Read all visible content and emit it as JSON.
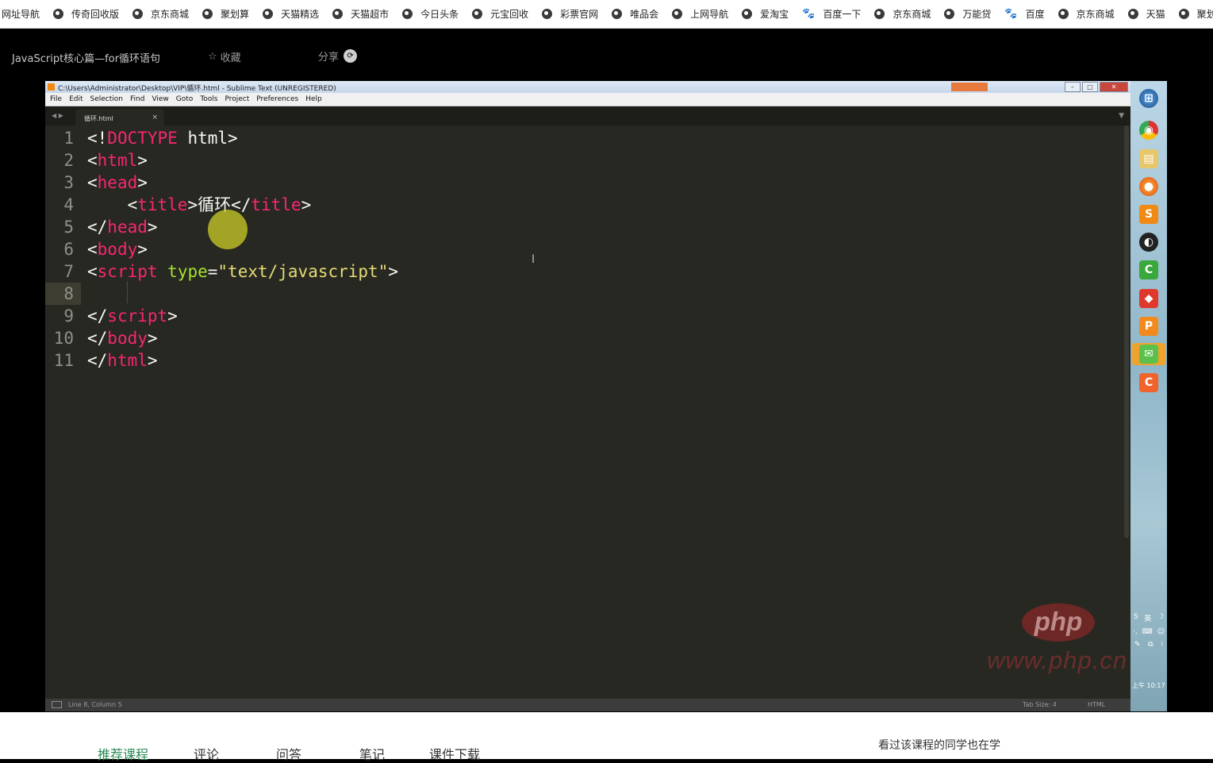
{
  "bookmarks": [
    {
      "label": "网址导航",
      "icon": "none"
    },
    {
      "label": "传奇回收版",
      "icon": "globe-icon"
    },
    {
      "label": "京东商城",
      "icon": "globe-icon"
    },
    {
      "label": "聚划算",
      "icon": "globe-icon"
    },
    {
      "label": "天猫精选",
      "icon": "globe-icon"
    },
    {
      "label": "天猫超市",
      "icon": "globe-icon"
    },
    {
      "label": "今日头条",
      "icon": "globe-icon"
    },
    {
      "label": "元宝回收",
      "icon": "globe-icon"
    },
    {
      "label": "彩票官网",
      "icon": "globe-icon"
    },
    {
      "label": "唯品会",
      "icon": "globe-icon"
    },
    {
      "label": "上网导航",
      "icon": "globe-icon"
    },
    {
      "label": "爱淘宝",
      "icon": "globe-icon"
    },
    {
      "label": "百度一下",
      "icon": "baidu-paw-icon"
    },
    {
      "label": "京东商城",
      "icon": "globe-icon"
    },
    {
      "label": "万能贷",
      "icon": "globe-icon"
    },
    {
      "label": "百度",
      "icon": "baidu-paw-icon"
    },
    {
      "label": "京东商城",
      "icon": "globe-icon"
    },
    {
      "label": "天猫",
      "icon": "globe-icon"
    },
    {
      "label": "聚划",
      "icon": "globe-icon"
    }
  ],
  "video": {
    "title": "JavaScript核心篇—for循环语句",
    "favorite_label": "收藏",
    "share_label": "分享"
  },
  "sublime": {
    "window_title": "C:\\Users\\Administrator\\Desktop\\VIP\\循环.html - Sublime Text (UNREGISTERED)",
    "menu": [
      "File",
      "Edit",
      "Selection",
      "Find",
      "View",
      "Goto",
      "Tools",
      "Project",
      "Preferences",
      "Help"
    ],
    "tab_name": "循环.html",
    "current_line": 8,
    "status_left": "Line 8, Column 5",
    "status_tab_size": "Tab Size: 4",
    "status_syntax": "HTML",
    "lines": [
      {
        "n": "1",
        "indent": "",
        "parts": [
          [
            "p",
            "<!"
          ],
          [
            "t",
            "DOCTYPE"
          ],
          [
            "p",
            " html>"
          ]
        ]
      },
      {
        "n": "2",
        "indent": "",
        "parts": [
          [
            "p",
            "<"
          ],
          [
            "t",
            "html"
          ],
          [
            "p",
            ">"
          ]
        ]
      },
      {
        "n": "3",
        "indent": "",
        "parts": [
          [
            "p",
            "<"
          ],
          [
            "t",
            "head"
          ],
          [
            "p",
            ">"
          ]
        ]
      },
      {
        "n": "4",
        "indent": "    ",
        "parts": [
          [
            "p",
            "<"
          ],
          [
            "t",
            "title"
          ],
          [
            "p",
            ">循环</"
          ],
          [
            "t",
            "title"
          ],
          [
            "p",
            ">"
          ]
        ]
      },
      {
        "n": "5",
        "indent": "",
        "parts": [
          [
            "p",
            "</"
          ],
          [
            "t",
            "head"
          ],
          [
            "p",
            ">"
          ]
        ]
      },
      {
        "n": "6",
        "indent": "",
        "parts": [
          [
            "p",
            "<"
          ],
          [
            "t",
            "body"
          ],
          [
            "p",
            ">"
          ]
        ]
      },
      {
        "n": "7",
        "indent": "",
        "parts": [
          [
            "p",
            "<"
          ],
          [
            "t",
            "script"
          ],
          [
            "p",
            " "
          ],
          [
            "a",
            "type"
          ],
          [
            "p",
            "="
          ],
          [
            "s",
            "\"text/javascript\""
          ],
          [
            "p",
            ">"
          ]
        ]
      },
      {
        "n": "8",
        "indent": "",
        "parts": []
      },
      {
        "n": "9",
        "indent": "",
        "parts": [
          [
            "p",
            "</"
          ],
          [
            "t",
            "script"
          ],
          [
            "p",
            ">"
          ]
        ]
      },
      {
        "n": "10",
        "indent": "",
        "parts": [
          [
            "p",
            "</"
          ],
          [
            "t",
            "body"
          ],
          [
            "p",
            ">"
          ]
        ]
      },
      {
        "n": "11",
        "indent": "",
        "parts": [
          [
            "p",
            "</"
          ],
          [
            "t",
            "html"
          ],
          [
            "p",
            ">"
          ]
        ]
      }
    ]
  },
  "watermark": {
    "logo": "php",
    "url": "www.php.cn"
  },
  "taskbar": {
    "apps": [
      "windows-start-icon",
      "chrome-icon",
      "file-explorer-icon",
      "firefox-icon",
      "sublime-icon",
      "obs-icon",
      "camtasia-green-icon",
      "app-red-icon",
      "orange-p-icon",
      "wechat-icon",
      "camtasia-orange-icon"
    ],
    "clock": "上午 10:17"
  },
  "bottom_tabs": [
    "推荐课程",
    "评论",
    "问答",
    "笔记",
    "课件下载"
  ],
  "related_title": "看过该课程的同学也在学",
  "colors": {
    "editor_bg": "#272822",
    "tag": "#f92672",
    "attr": "#a6e22e",
    "string": "#e6db74",
    "active_tab": "#2e8b57"
  }
}
